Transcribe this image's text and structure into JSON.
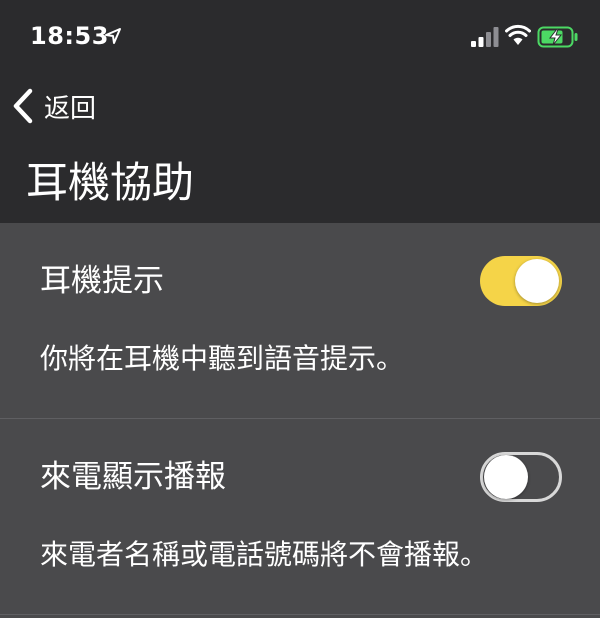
{
  "status_bar": {
    "time": "18:53",
    "icons": [
      "location-arrow-icon",
      "cellular-signal-icon",
      "wifi-icon",
      "battery-charging-icon"
    ]
  },
  "nav": {
    "back_label": "返回",
    "title": "耳機協助"
  },
  "settings": [
    {
      "label": "耳機提示",
      "description": "你將在耳機中聽到語音提示。",
      "enabled": true
    },
    {
      "label": "來電顯示播報",
      "description": "來電者名稱或電話號碼將不會播報。",
      "enabled": false
    }
  ],
  "colors": {
    "header_bg": "#2b2b2d",
    "content_bg": "#4a4a4c",
    "toggle_on": "#f5d448",
    "battery_charging": "#4cd964"
  }
}
